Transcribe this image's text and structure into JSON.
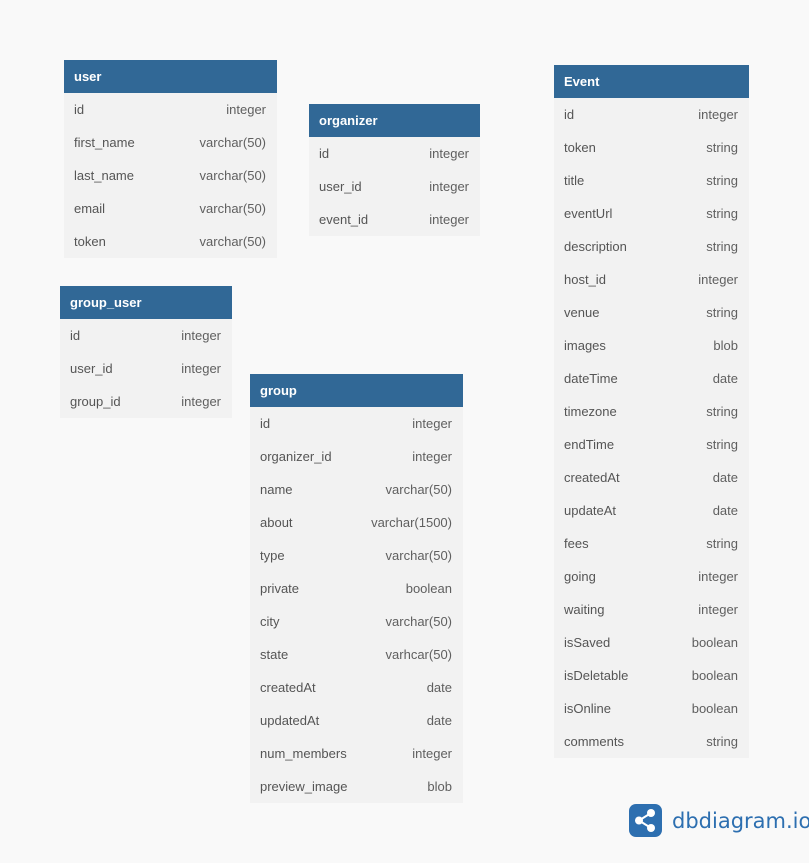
{
  "tables": {
    "user": {
      "name": "user",
      "rows": [
        {
          "field": "id",
          "type": "integer"
        },
        {
          "field": "first_name",
          "type": "varchar(50)"
        },
        {
          "field": "last_name",
          "type": "varchar(50)"
        },
        {
          "field": "email",
          "type": "varchar(50)"
        },
        {
          "field": "token",
          "type": "varchar(50)"
        }
      ]
    },
    "organizer": {
      "name": "organizer",
      "rows": [
        {
          "field": "id",
          "type": "integer"
        },
        {
          "field": "user_id",
          "type": "integer"
        },
        {
          "field": "event_id",
          "type": "integer"
        }
      ]
    },
    "group_user": {
      "name": "group_user",
      "rows": [
        {
          "field": "id",
          "type": "integer"
        },
        {
          "field": "user_id",
          "type": "integer"
        },
        {
          "field": "group_id",
          "type": "integer"
        }
      ]
    },
    "group": {
      "name": "group",
      "rows": [
        {
          "field": "id",
          "type": "integer"
        },
        {
          "field": "organizer_id",
          "type": "integer"
        },
        {
          "field": "name",
          "type": "varchar(50)"
        },
        {
          "field": "about",
          "type": "varchar(1500)"
        },
        {
          "field": "type",
          "type": "varchar(50)"
        },
        {
          "field": "private",
          "type": "boolean"
        },
        {
          "field": "city",
          "type": "varchar(50)"
        },
        {
          "field": "state",
          "type": "varhcar(50)"
        },
        {
          "field": "createdAt",
          "type": "date"
        },
        {
          "field": "updatedAt",
          "type": "date"
        },
        {
          "field": "num_members",
          "type": "integer"
        },
        {
          "field": "preview_image",
          "type": "blob"
        }
      ]
    },
    "event": {
      "name": "Event",
      "rows": [
        {
          "field": "id",
          "type": "integer"
        },
        {
          "field": "token",
          "type": "string"
        },
        {
          "field": "title",
          "type": "string"
        },
        {
          "field": "eventUrl",
          "type": "string"
        },
        {
          "field": "description",
          "type": "string"
        },
        {
          "field": "host_id",
          "type": "integer"
        },
        {
          "field": "venue",
          "type": "string"
        },
        {
          "field": "images",
          "type": "blob"
        },
        {
          "field": "dateTime",
          "type": "date"
        },
        {
          "field": "timezone",
          "type": "string"
        },
        {
          "field": "endTime",
          "type": "string"
        },
        {
          "field": "createdAt",
          "type": "date"
        },
        {
          "field": "updateAt",
          "type": "date"
        },
        {
          "field": "fees",
          "type": "string"
        },
        {
          "field": "going",
          "type": "integer"
        },
        {
          "field": "waiting",
          "type": "integer"
        },
        {
          "field": "isSaved",
          "type": "boolean"
        },
        {
          "field": "isDeletable",
          "type": "boolean"
        },
        {
          "field": "isOnline",
          "type": "boolean"
        },
        {
          "field": "comments",
          "type": "string"
        }
      ]
    }
  },
  "brand": {
    "text": "dbdiagram.io",
    "icon": "share-nodes-icon",
    "color": "#2d6fb0"
  },
  "colors": {
    "header": "#316896",
    "body": "#f2f2f2",
    "background": "#f9f9f9"
  }
}
